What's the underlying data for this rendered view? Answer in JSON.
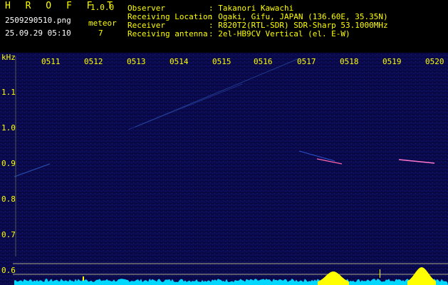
{
  "app": {
    "name": "H R O F F T",
    "version": "1.0.0"
  },
  "file": {
    "name": "2509290510.png",
    "datetime": "25.09.29 05:10"
  },
  "counter": {
    "label": "meteor",
    "value": "7"
  },
  "info": [
    {
      "label": "Observer",
      "value": ": Takanori Kawachi"
    },
    {
      "label": "Receiving Location",
      "value": ": Ogaki, Gifu, JAPAN (136.60E, 35.35N)"
    },
    {
      "label": "Receiver",
      "value": ": R820T2(RTL-SDR) SDR-Sharp 53.1000MHz"
    },
    {
      "label": "Receiving antenna",
      "value": ": 2el-HB9CV Vertical (el. E-W)"
    }
  ],
  "x_axis": {
    "ticks": [
      "0511",
      "0512",
      "0513",
      "0514",
      "0515",
      "0516",
      "0517",
      "0518",
      "0519",
      "0520"
    ]
  },
  "y_axis": {
    "unit": "kHz",
    "ticks": [
      "1.1",
      "1.0",
      "0.9",
      "0.8",
      "0.7",
      "0.6"
    ]
  },
  "colors": {
    "label": "#ffff00",
    "value": "#00ffff",
    "bg": "#000000",
    "plot": "#0a0a50",
    "spectrum": "#00ffff",
    "peak": "#ffff00"
  }
}
